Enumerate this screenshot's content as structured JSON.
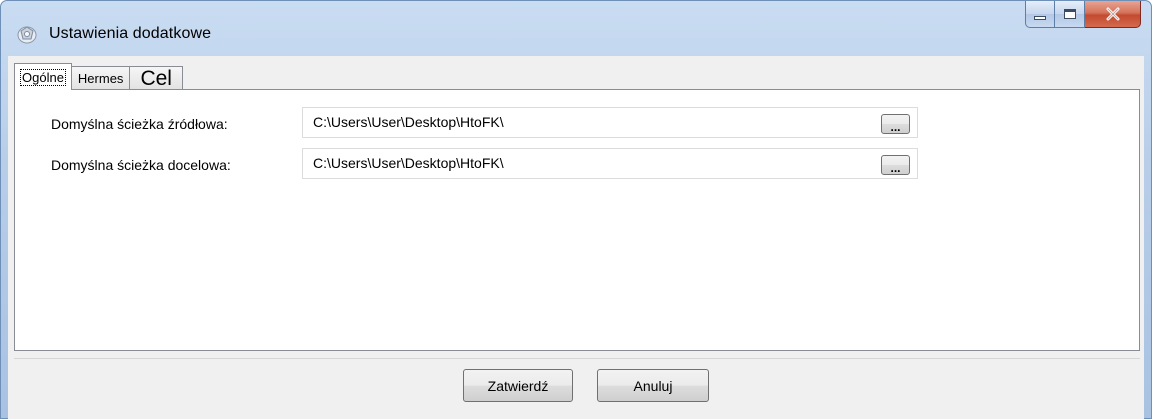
{
  "window": {
    "title": "Ustawienia dodatkowe",
    "icon": "settings-app-icon"
  },
  "caption_buttons": {
    "minimize_icon": "minimize-icon",
    "maximize_icon": "maximize-icon",
    "close_label": "X"
  },
  "tabs": [
    {
      "label": "Ogólne",
      "active": true
    },
    {
      "label": "Hermes",
      "active": false
    },
    {
      "label": "Cel",
      "active": false
    }
  ],
  "settings": {
    "source_path_label": "Domyślna ścieżka źródłowa:",
    "source_path_value": "C:\\Users\\User\\Desktop\\HtoFK\\",
    "target_path_label": "Domyślna ścieżka docelowa:",
    "target_path_value": "C:\\Users\\User\\Desktop\\HtoFK\\",
    "browse_label": "..."
  },
  "buttons": {
    "ok_label": "Zatwierdź",
    "cancel_label": "Anuluj"
  },
  "colors": {
    "title_bar": "#b7cde8",
    "close_button": "#c24a2f",
    "client_background": "#f0f0f0"
  }
}
